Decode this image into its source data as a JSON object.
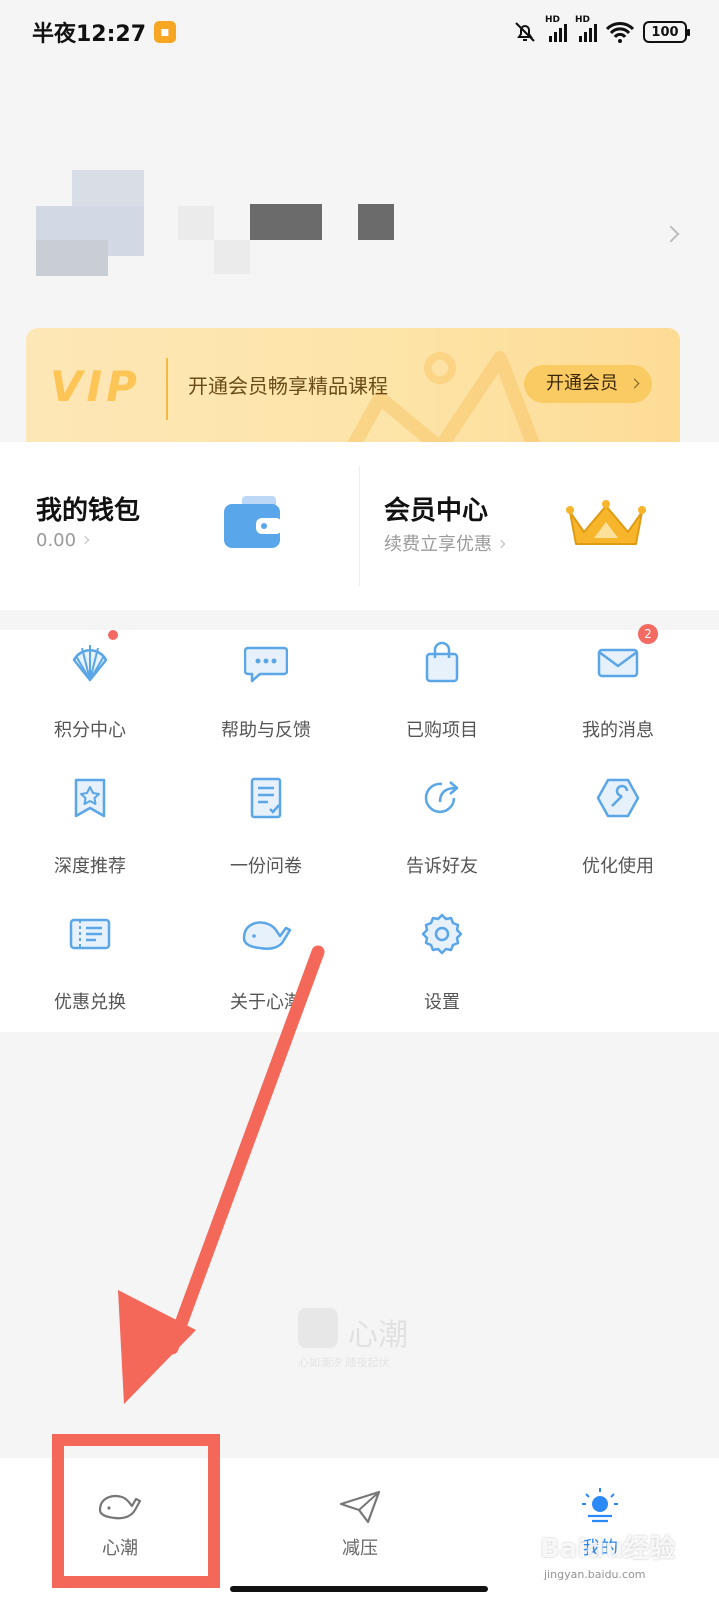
{
  "status_bar": {
    "time": "半夜12:27",
    "network_hd_1": "HD",
    "network_hd_2": "HD",
    "battery": "100"
  },
  "vip": {
    "logo": "VIP",
    "text": "开通会员畅享精品课程",
    "button": "开通会员"
  },
  "wallet": {
    "title": "我的钱包",
    "balance": "0.00"
  },
  "member_center": {
    "title": "会员中心",
    "subtitle": "续费立享优惠"
  },
  "menu": {
    "items": [
      {
        "label": "积分中心",
        "icon": "shell-icon"
      },
      {
        "label": "帮助与反馈",
        "icon": "chat-bubble-icon"
      },
      {
        "label": "已购项目",
        "icon": "shopping-bag-icon"
      },
      {
        "label": "我的消息",
        "icon": "mail-icon",
        "badge": "2"
      },
      {
        "label": "深度推荐",
        "icon": "bookmark-star-icon"
      },
      {
        "label": "一份问卷",
        "icon": "questionnaire-icon"
      },
      {
        "label": "告诉好友",
        "icon": "share-icon"
      },
      {
        "label": "优化使用",
        "icon": "wrench-hexagon-icon"
      },
      {
        "label": "优惠兑换",
        "icon": "coupon-icon"
      },
      {
        "label": "关于心潮",
        "icon": "whale-icon"
      },
      {
        "label": "设置",
        "icon": "gear-icon"
      }
    ]
  },
  "watermark": {
    "name": "心潮",
    "slogan": "心如潮汐 随夜起伏"
  },
  "bottom_nav": {
    "items": [
      {
        "label": "心潮",
        "icon": "whale-icon"
      },
      {
        "label": "减压",
        "icon": "paper-plane-icon"
      },
      {
        "label": "我的",
        "icon": "sun-person-icon",
        "active": true
      }
    ]
  },
  "overlay": {
    "baidu_mark": "Baidu经验",
    "baidu_url": "jingyan.baidu.com"
  },
  "colors": {
    "accent": "#2b8af7",
    "icon_blue": "#5aa6e6",
    "badge_red": "#f26a62",
    "annotation_red": "#f4685a",
    "vip_gold": "#fbcb63"
  }
}
